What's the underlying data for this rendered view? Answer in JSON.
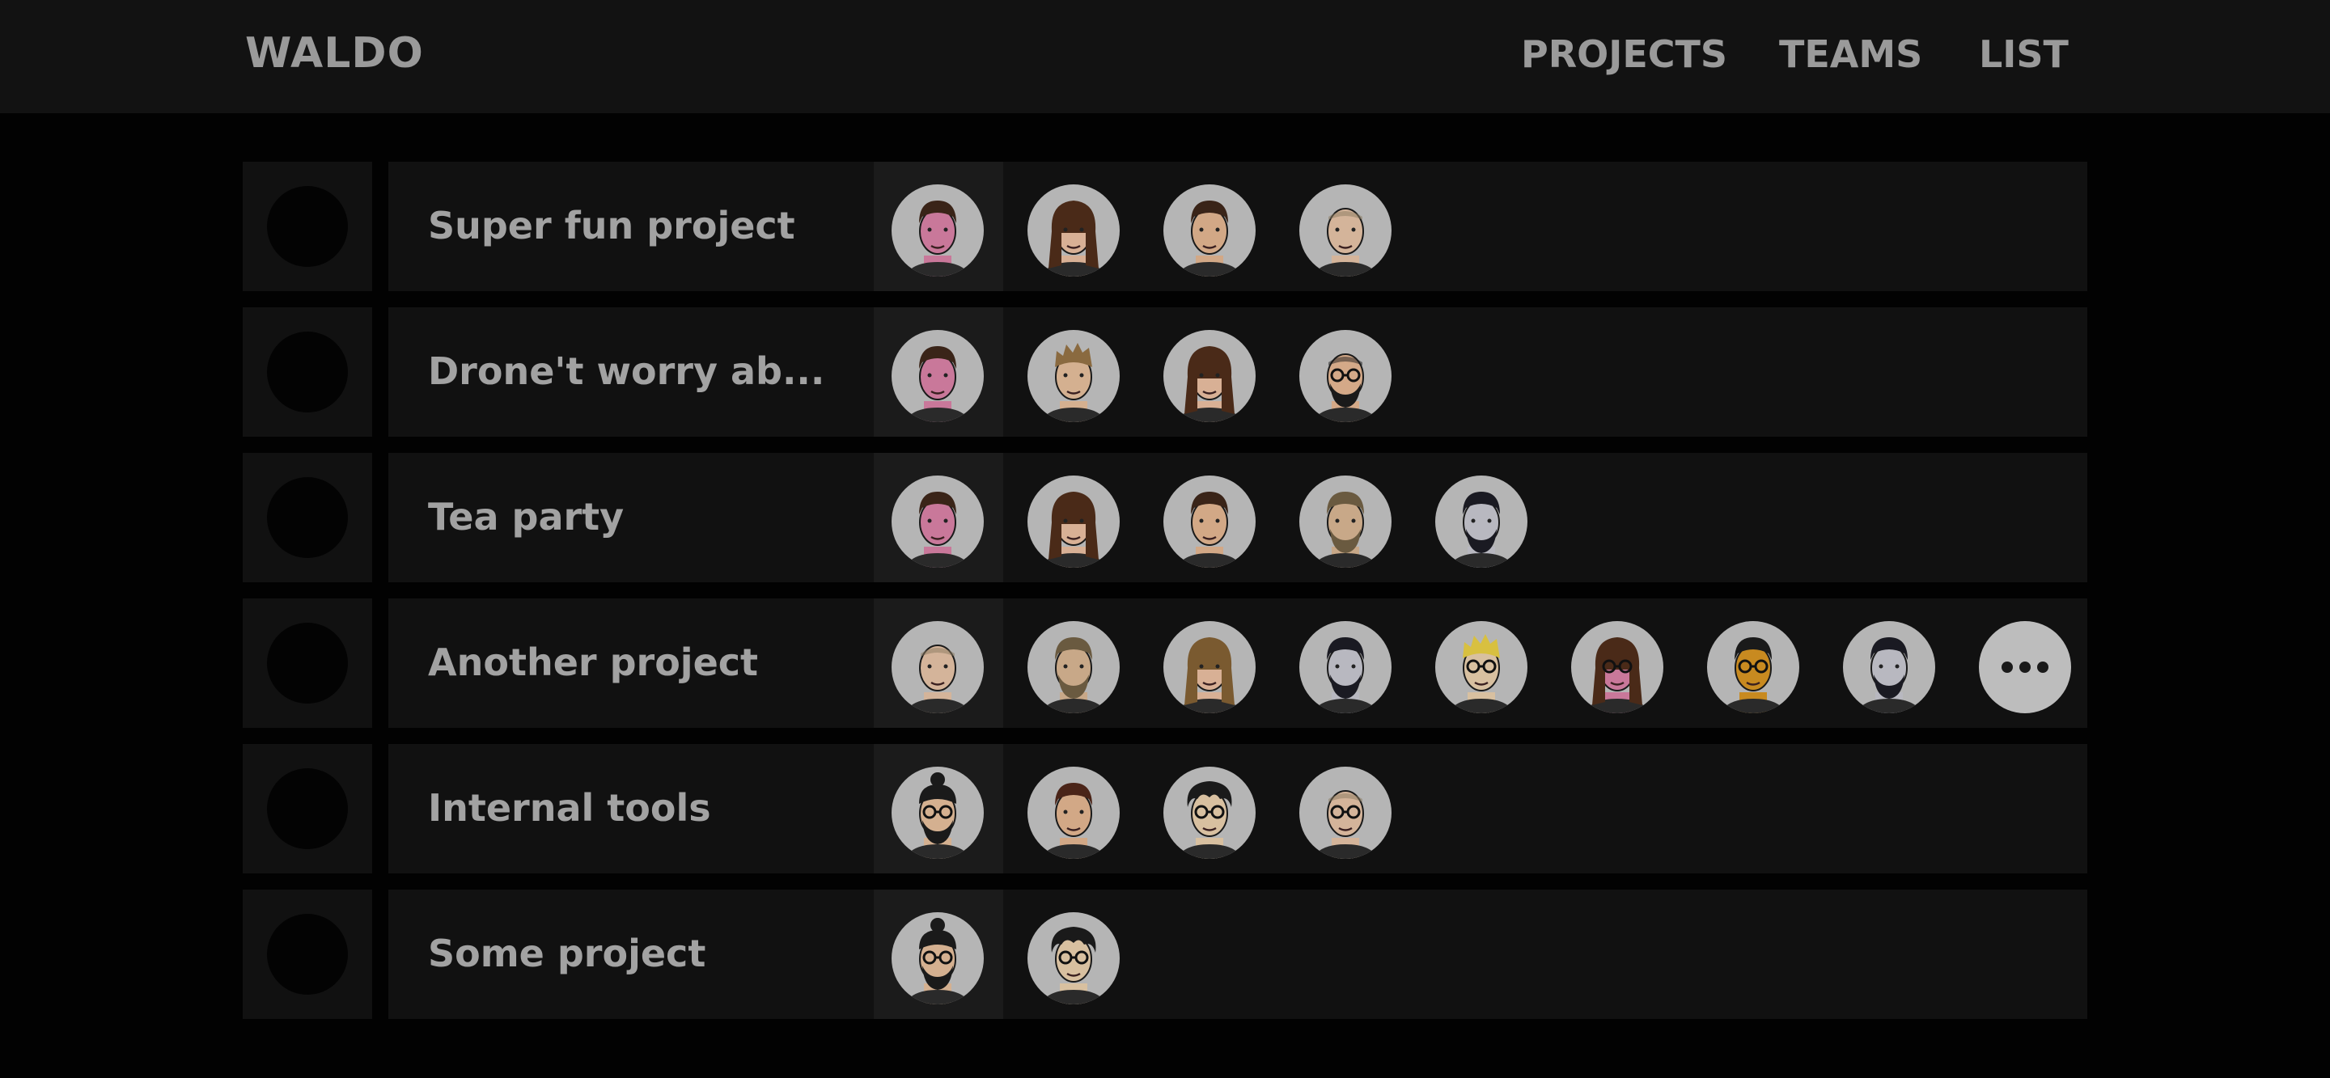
{
  "app": {
    "brand": "WALDO"
  },
  "nav": [
    {
      "id": "projects",
      "label": "PROJECTS"
    },
    {
      "id": "teams",
      "label": "TEAMS"
    },
    {
      "id": "list",
      "label": "LIST"
    }
  ],
  "projects": [
    {
      "name": "Super fun project",
      "members": [
        {
          "skin": "#c9789a",
          "hair": "#3a2418",
          "style": "short",
          "glasses": false,
          "beard": false
        },
        {
          "skin": "#d8b095",
          "hair": "#4a2a18",
          "style": "long",
          "glasses": false,
          "beard": false
        },
        {
          "skin": "#d2a886",
          "hair": "#3a2418",
          "style": "short",
          "glasses": false,
          "beard": false
        },
        {
          "skin": "#d4b49a",
          "hair": "#8a7a60",
          "style": "bald",
          "glasses": false,
          "beard": false
        }
      ],
      "more": false
    },
    {
      "name": "Drone't worry ab...",
      "members": [
        {
          "skin": "#c9789a",
          "hair": "#3a2418",
          "style": "short",
          "glasses": false,
          "beard": false
        },
        {
          "skin": "#d4b090",
          "hair": "#8a6a40",
          "style": "spiky",
          "glasses": false,
          "beard": false
        },
        {
          "skin": "#d8b095",
          "hair": "#4a2a18",
          "style": "long",
          "glasses": false,
          "beard": false
        },
        {
          "skin": "#d4a988",
          "hair": "#1a1a1a",
          "style": "bald",
          "glasses": true,
          "beard": true
        }
      ],
      "more": false
    },
    {
      "name": "Tea party",
      "members": [
        {
          "skin": "#c9789a",
          "hair": "#3a2418",
          "style": "short",
          "glasses": false,
          "beard": false
        },
        {
          "skin": "#d8b095",
          "hair": "#4a2a18",
          "style": "long",
          "glasses": false,
          "beard": false
        },
        {
          "skin": "#d2a886",
          "hair": "#3a2418",
          "style": "short",
          "glasses": false,
          "beard": false
        },
        {
          "skin": "#c8a888",
          "hair": "#6a5a40",
          "style": "short",
          "glasses": false,
          "beard": true
        },
        {
          "skin": "#b8b8c0",
          "hair": "#1a1a22",
          "style": "short",
          "glasses": false,
          "beard": true
        }
      ],
      "more": false
    },
    {
      "name": "Another project",
      "members": [
        {
          "skin": "#d4b49a",
          "hair": "#8a7a60",
          "style": "bald",
          "glasses": false,
          "beard": false
        },
        {
          "skin": "#c8a888",
          "hair": "#6a5a40",
          "style": "short",
          "glasses": false,
          "beard": true
        },
        {
          "skin": "#d8b095",
          "hair": "#7a5a30",
          "style": "long",
          "glasses": false,
          "beard": false
        },
        {
          "skin": "#b8b8c0",
          "hair": "#1a1a22",
          "style": "short",
          "glasses": false,
          "beard": true
        },
        {
          "skin": "#d8c0a0",
          "hair": "#d8c040",
          "style": "spiky",
          "glasses": true,
          "beard": false
        },
        {
          "skin": "#c9789a",
          "hair": "#4a2a18",
          "style": "long",
          "glasses": true,
          "beard": false
        },
        {
          "skin": "#c88a20",
          "hair": "#1a1a1a",
          "style": "short",
          "glasses": true,
          "beard": false
        },
        {
          "skin": "#b8b8c0",
          "hair": "#1a1a22",
          "style": "short",
          "glasses": false,
          "beard": true
        }
      ],
      "more": true
    },
    {
      "name": "Internal tools",
      "members": [
        {
          "skin": "#d4b090",
          "hair": "#1a1a1a",
          "style": "bun",
          "glasses": true,
          "beard": true
        },
        {
          "skin": "#d2a886",
          "hair": "#4a2418",
          "style": "short",
          "glasses": false,
          "beard": false
        },
        {
          "skin": "#d8c0a0",
          "hair": "#1a1a1a",
          "style": "curly",
          "glasses": true,
          "beard": false
        },
        {
          "skin": "#d4b49a",
          "hair": "#8a7a60",
          "style": "bald",
          "glasses": true,
          "beard": false
        }
      ],
      "more": false
    },
    {
      "name": "Some project",
      "members": [
        {
          "skin": "#d4b090",
          "hair": "#1a1a1a",
          "style": "bun",
          "glasses": true,
          "beard": true
        },
        {
          "skin": "#d8c0a0",
          "hair": "#1a1a1a",
          "style": "curly",
          "glasses": true,
          "beard": false
        }
      ],
      "more": false
    }
  ]
}
